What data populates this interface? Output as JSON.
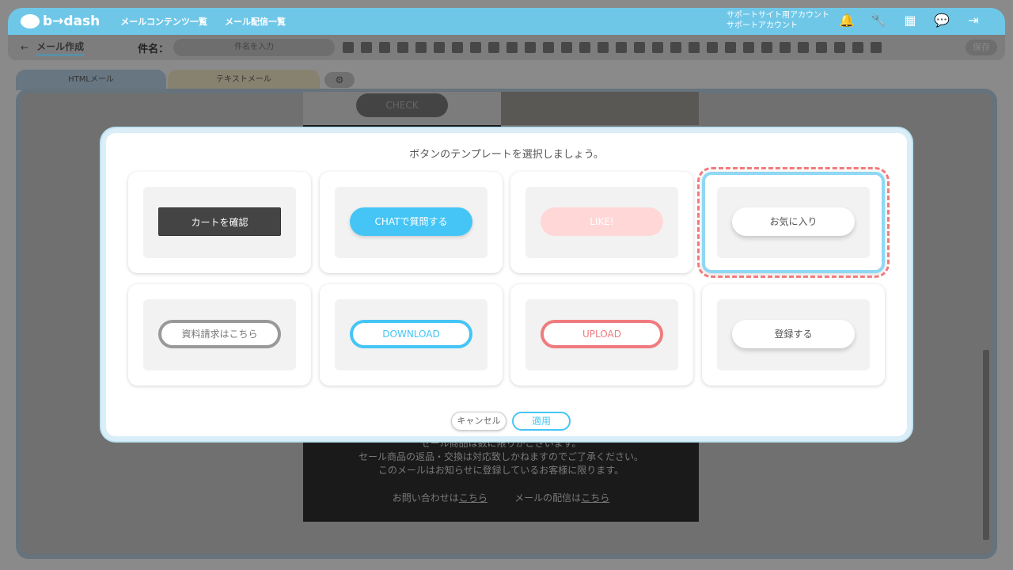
{
  "app": {
    "logo_text": "b→dash"
  },
  "topnav": {
    "contents": "メールコンテンツ一覧",
    "delivery": "メール配信一覧"
  },
  "account": {
    "line1": "サポートサイト用アカウント",
    "line2": "サポートアカウント"
  },
  "toolbar": {
    "back": "←",
    "page_title": "メール作成",
    "subject_label": "件名：",
    "subject_placeholder": "件名を入力",
    "save": "保存"
  },
  "tabs": {
    "html": "HTMLメール",
    "text": "テキストメール",
    "settings": "⚙"
  },
  "email": {
    "check_button": "CHECK",
    "footer_line1": "セール商品は数に限りがございます。",
    "footer_line2": "セール商品の返品・交換は対応致しかねますのでご了承ください。",
    "footer_line3": "このメールはお知らせに登録しているお客様に限ります。",
    "contact_prefix": "お問い合わせは",
    "contact_link": "こちら",
    "delivery_prefix": "メールの配信は",
    "delivery_link": "こちら"
  },
  "modal": {
    "title": "ボタンのテンプレートを選択しましょう。",
    "templates": [
      {
        "label": "カートを確認"
      },
      {
        "label": "CHATで質問する"
      },
      {
        "label": "LIKE!"
      },
      {
        "label": "お気に入り"
      },
      {
        "label": "資料請求はこちら"
      },
      {
        "label": "DOWNLOAD"
      },
      {
        "label": "UPLOAD"
      },
      {
        "label": "登録する"
      }
    ],
    "cancel": "キャンセル",
    "apply": "適用"
  }
}
